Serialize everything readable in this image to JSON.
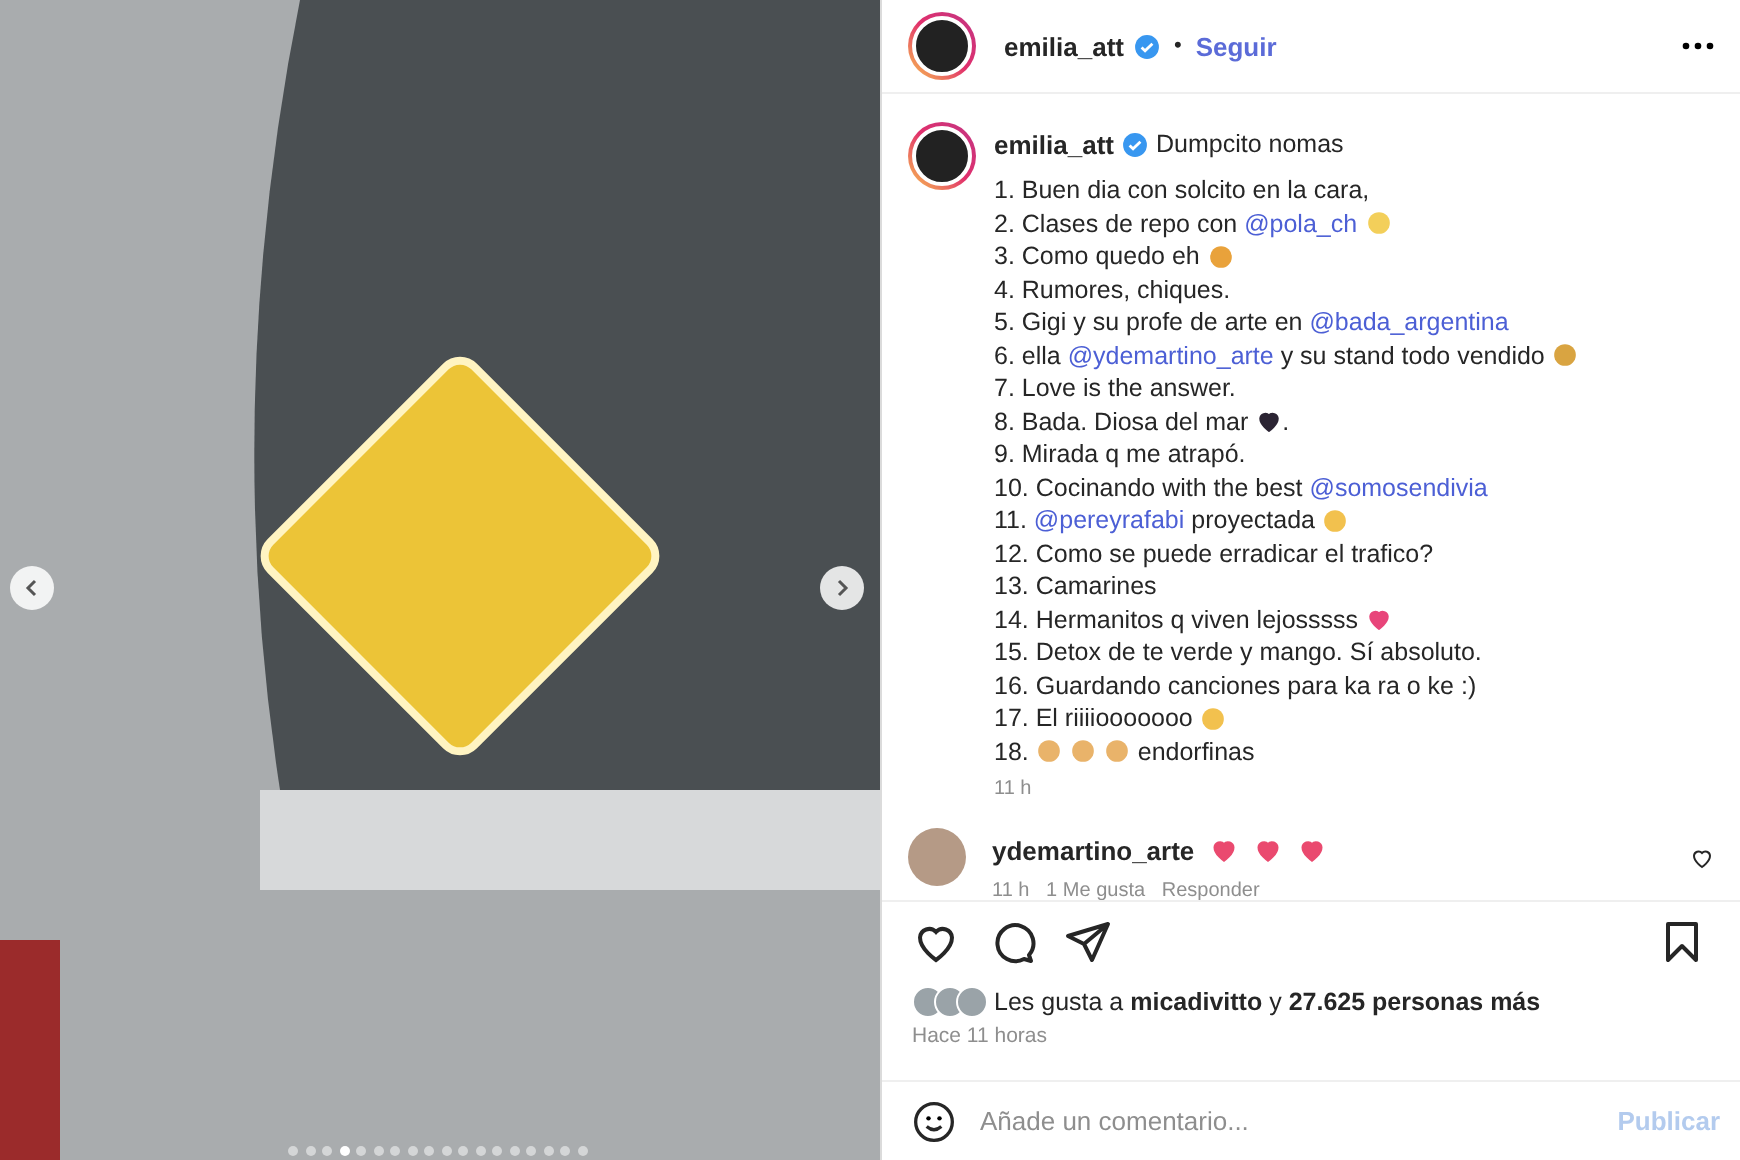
{
  "photo": {
    "dots": [
      {
        "selected": false
      },
      {
        "selected": false
      },
      {
        "selected": false
      },
      {
        "selected": true
      },
      {
        "selected": false
      },
      {
        "selected": false
      },
      {
        "selected": false
      },
      {
        "selected": false
      },
      {
        "selected": false
      },
      {
        "selected": false
      },
      {
        "selected": false
      },
      {
        "selected": false
      },
      {
        "selected": false
      },
      {
        "selected": false
      },
      {
        "selected": false
      },
      {
        "selected": false
      },
      {
        "selected": false
      },
      {
        "selected": false
      }
    ]
  },
  "header": {
    "username": "emilia_att",
    "verified": true,
    "separator": "•",
    "follow": "Seguir"
  },
  "caption": {
    "username": "emilia_att",
    "verified": true,
    "title": "Dumpcito nomas",
    "lines": [
      [
        {
          "kind": "text",
          "text": "1. Buen dia con solcito en la cara,"
        }
      ],
      [
        {
          "kind": "text",
          "text": "2. Clases de repo con "
        },
        {
          "kind": "mention",
          "text": "@pola_ch"
        },
        {
          "kind": "emoji",
          "color": "#f3cf5a"
        }
      ],
      [
        {
          "kind": "text",
          "text": "3. Como quedo eh"
        },
        {
          "kind": "emoji",
          "color": "#e9a23b"
        }
      ],
      [
        {
          "kind": "text",
          "text": "4. Rumores, chiques."
        }
      ],
      [
        {
          "kind": "text",
          "text": "5. Gigi y su profe de arte en "
        },
        {
          "kind": "mention",
          "text": "@bada_argentina"
        }
      ],
      [
        {
          "kind": "text",
          "text": "6. ella "
        },
        {
          "kind": "mention",
          "text": "@ydemartino_arte"
        },
        {
          "kind": "text",
          "text": " y su stand todo vendido"
        },
        {
          "kind": "emoji",
          "color": "#d9a441"
        }
      ],
      [
        {
          "kind": "text",
          "text": "7. Love is the answer."
        }
      ],
      [
        {
          "kind": "text",
          "text": "8. Bada. Diosa del mar"
        },
        {
          "kind": "heart",
          "color": "#2b2433"
        },
        {
          "kind": "text",
          "text": "."
        }
      ],
      [
        {
          "kind": "text",
          "text": "9. Mirada q me atrapó."
        }
      ],
      [
        {
          "kind": "text",
          "text": "10. Cocinando with the best "
        },
        {
          "kind": "mention",
          "text": "@somosendivia"
        }
      ],
      [
        {
          "kind": "text",
          "text": "11. "
        },
        {
          "kind": "mention",
          "text": "@pereyrafabi"
        },
        {
          "kind": "text",
          "text": " proyectada"
        },
        {
          "kind": "emoji",
          "color": "#f2c14e"
        }
      ],
      [
        {
          "kind": "text",
          "text": "12. Como se puede erradicar el trafico?"
        }
      ],
      [
        {
          "kind": "text",
          "text": "13. Camarines"
        }
      ],
      [
        {
          "kind": "text",
          "text": "14. Hermanitos q viven lejosssss"
        },
        {
          "kind": "heart",
          "color": "#e8457a"
        }
      ],
      [
        {
          "kind": "text",
          "text": "15. Detox de te verde y mango. Sí absoluto."
        }
      ],
      [
        {
          "kind": "text",
          "text": "16. Guardando canciones para ka ra o ke :)"
        }
      ],
      [
        {
          "kind": "text",
          "text": "17. El riiiiooooooo"
        },
        {
          "kind": "emoji",
          "color": "#f2c14e"
        }
      ],
      [
        {
          "kind": "text",
          "text": "18."
        },
        {
          "kind": "emoji",
          "color": "#e9b36a"
        },
        {
          "kind": "emoji",
          "color": "#e9b36a"
        },
        {
          "kind": "emoji",
          "color": "#e9b36a"
        },
        {
          "kind": "text",
          "text": " endorfinas"
        }
      ]
    ],
    "time": "11 h"
  },
  "comments": [
    {
      "username": "ydemartino_arte",
      "hearts": [
        {
          "color": "#ea4a6f"
        },
        {
          "color": "#ea4a6f"
        },
        {
          "color": "#ea4a6f"
        }
      ],
      "meta": "11 h   1 Me gusta   Responder",
      "liked": false
    }
  ],
  "actions": {
    "liked": false,
    "saved": false
  },
  "likes": {
    "prefix": "Les gusta a ",
    "user": "micadivitto",
    "middle": " y ",
    "count": "27.625 personas más"
  },
  "posted": "Hace 11 horas",
  "composer": {
    "placeholder": "Añade un comentario...",
    "submit": "Publicar"
  }
}
